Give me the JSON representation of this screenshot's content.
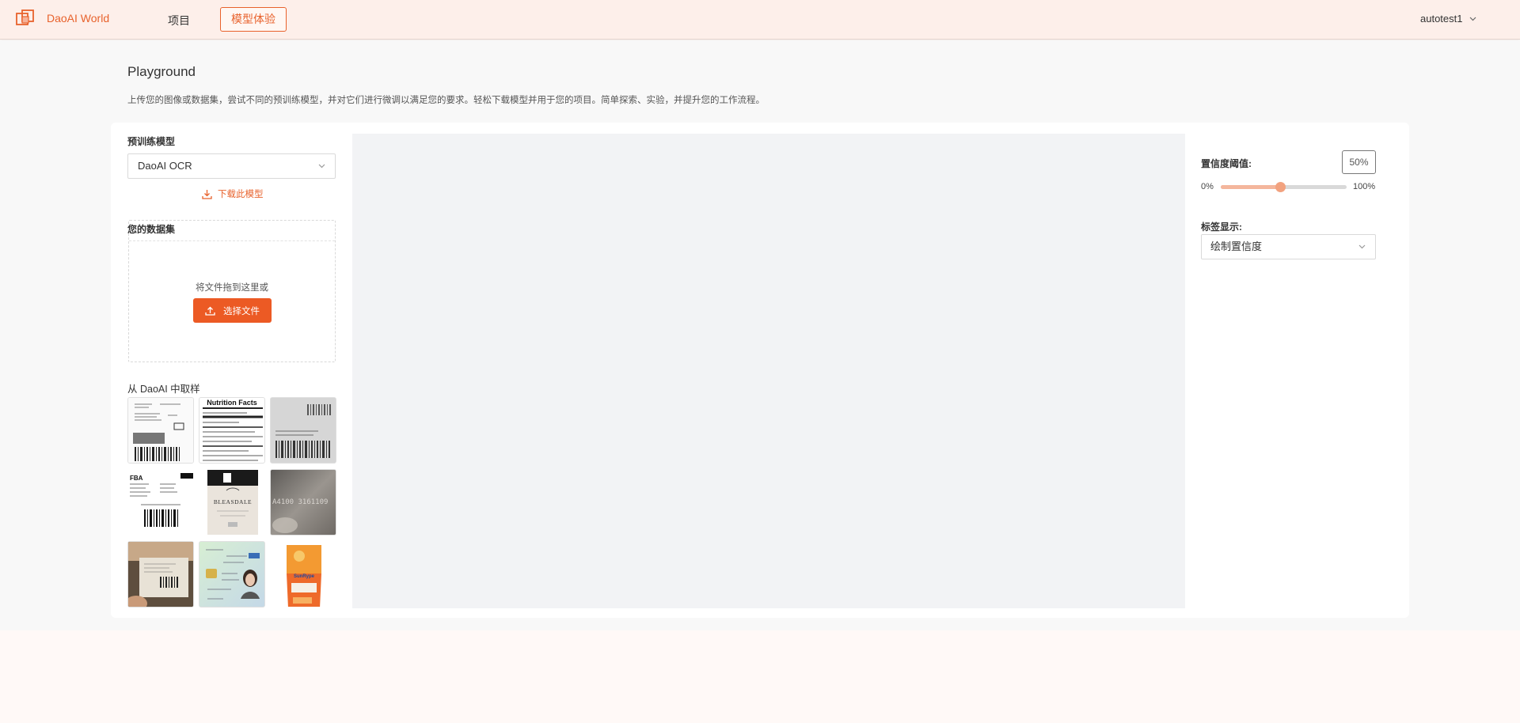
{
  "header": {
    "brand": "DaoAI World",
    "nav": {
      "projects": "项目",
      "playground": "模型体验"
    },
    "user": "autotest1"
  },
  "page": {
    "title": "Playground",
    "description": "上传您的图像或数据集，尝试不同的预训练模型，并对它们进行微调以满足您的要求。轻松下载模型并用于您的项目。简单探索、实验，并提升您的工作流程。"
  },
  "left": {
    "model_label": "预训练模型",
    "model_selected": "DaoAI OCR",
    "download_label": "下载此模型",
    "dataset_label": "您的数据集",
    "drop_text": "将文件拖到这里或",
    "upload_label": "选择文件",
    "samples_label": "从 DaoAI 中取样"
  },
  "samples": [
    {
      "name": "shipping-label",
      "text": ""
    },
    {
      "name": "nutrition-facts",
      "text": "Nutrition Facts"
    },
    {
      "name": "barcode-sticker",
      "text": ""
    },
    {
      "name": "fba-label",
      "text": "FBA"
    },
    {
      "name": "wine-bottle",
      "text": "BLEASDALE"
    },
    {
      "name": "metal-engraving",
      "text": "A4100 3161109"
    },
    {
      "name": "package-box",
      "text": ""
    },
    {
      "name": "id-card",
      "text": ""
    },
    {
      "name": "sunrype-package",
      "text": "SunRype"
    }
  ],
  "right": {
    "threshold_label": "置信度阈值:",
    "threshold_value": "50%",
    "threshold_fraction": 0.47,
    "slider_min": "0%",
    "slider_max": "100%",
    "tag_label": "标签显示:",
    "tag_selected": "绘制置信度"
  },
  "colors": {
    "accent": "#e8622c",
    "button": "#ec5a24",
    "header_bg": "#fdefea",
    "canvas_bg": "#f2f3f5"
  },
  "icons": {
    "logo": "daoai-logo-icon",
    "chevron": "chevron-down-icon",
    "download": "download-icon",
    "upload": "upload-icon"
  }
}
